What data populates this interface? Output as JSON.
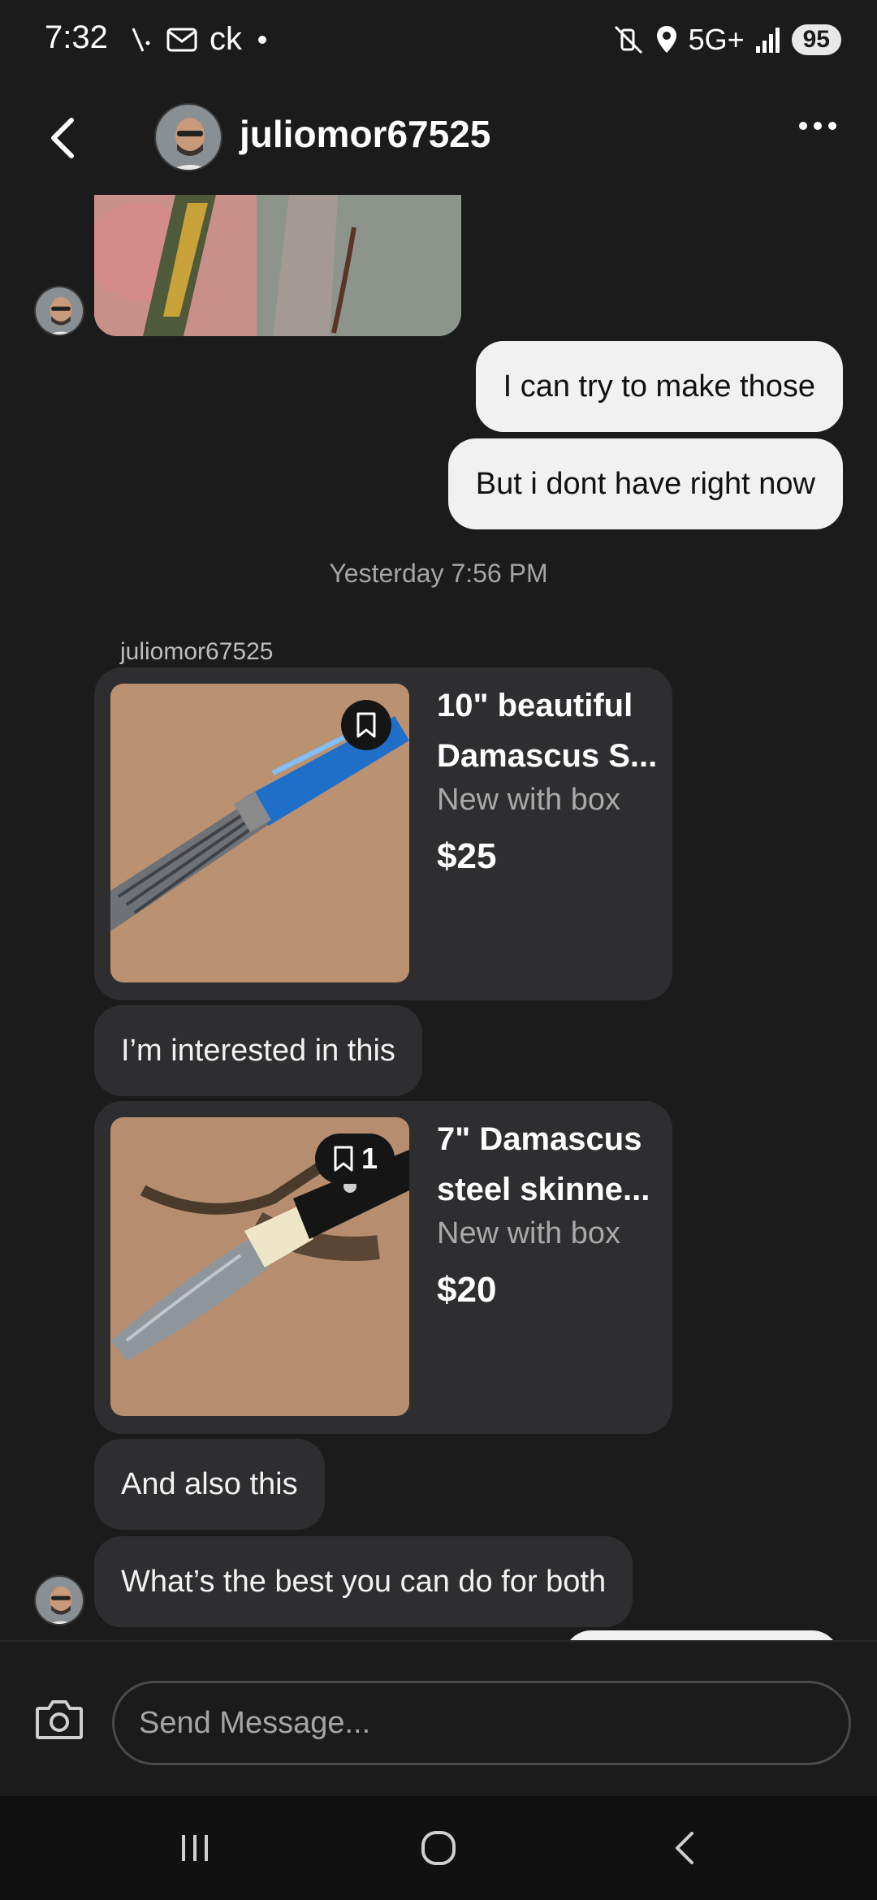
{
  "status_bar": {
    "time": "7:32",
    "left_icons": [
      "signal-slash-icon",
      "mail-icon"
    ],
    "app_text": "ck",
    "network": "5G+",
    "battery": "95"
  },
  "header": {
    "username": "juliomor67525"
  },
  "messages": {
    "out_1": "I can try to make those",
    "out_2": "But i dont have right now",
    "timestamp": "Yesterday 7:56 PM",
    "sender_label": "juliomor67525",
    "in_1": "I’m interested in this",
    "in_2": "And also this",
    "in_3": "What’s the best you can do for both"
  },
  "listings": [
    {
      "title_line1": "10\" beautiful",
      "title_line2": "Damascus S...",
      "condition": "New with box",
      "price": "$25",
      "save_count": ""
    },
    {
      "title_line1": "7\" Damascus",
      "title_line2": "steel skinne...",
      "condition": "New with box",
      "price": "$20",
      "save_count": "1"
    }
  ],
  "composer": {
    "placeholder": "Send Message..."
  },
  "colors": {
    "background": "#1b1b1c",
    "bubble_in": "#2e2e30",
    "bubble_out": "#f1f1f1",
    "muted_text": "#a5a5a5"
  }
}
